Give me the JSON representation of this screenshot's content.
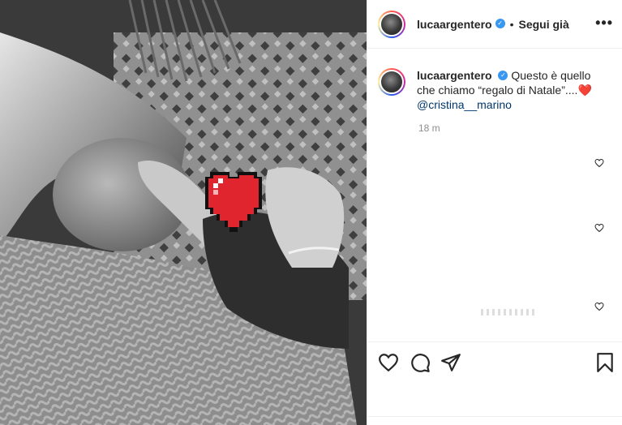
{
  "post": {
    "username": "lucaargentero",
    "verified": true,
    "separator": "•",
    "follow_label": "Segui già",
    "more_icon": "more-horizontal-icon",
    "caption_text": "Questo è quello che chiamo “regalo di Natale”....",
    "caption_emoji": "❤️",
    "mention": "@cristina__marino",
    "timestamp": "18 m"
  },
  "image": {
    "description_icon": "pixel-heart-sticker",
    "sticker_color": "#e0252e"
  },
  "actions": {
    "like_icon": "heart-icon",
    "comment_icon": "comment-icon",
    "share_icon": "share-icon",
    "save_icon": "bookmark-icon"
  },
  "colors": {
    "verified_blue": "#3897f0",
    "mention_blue": "#00376b",
    "muted_gray": "#8e8e8e",
    "border": "#efefef"
  }
}
